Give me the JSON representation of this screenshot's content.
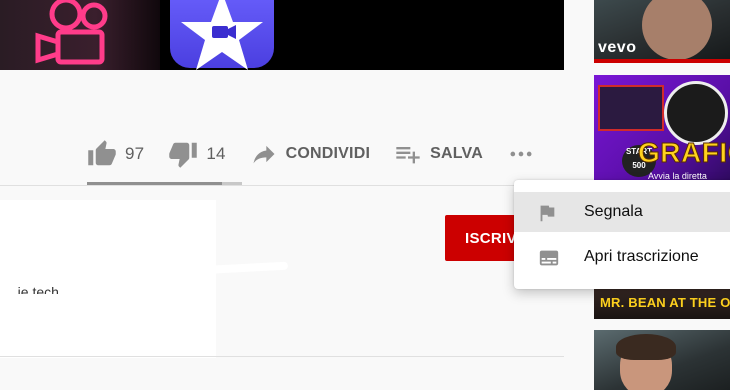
{
  "actions": {
    "like_count": "97",
    "dislike_count": "14",
    "share_label": "CONDIVIDI",
    "save_label": "SALVA",
    "like_ratio": 0.87
  },
  "channel": {
    "subscribe_label": "ISCRIV",
    "partial_text": "...ie tech"
  },
  "menu": {
    "items": [
      {
        "label": "Segnala",
        "icon": "flag-icon"
      },
      {
        "label": "Apri trascrizione",
        "icon": "transcript-icon"
      }
    ]
  },
  "sidebar": {
    "thumb1_badge": "vevo",
    "thumb2_title": "GRAFIC",
    "thumb2_badge": "START\n500",
    "thumb2_caption": "Avvia la diretta",
    "thumb3_title": "MR. BEAN AT THE OLYMPIC"
  },
  "colors": {
    "brand_red": "#cc0000",
    "icon_gray": "#909090",
    "text_gray": "#606060",
    "menu_hover": "#e6e6e6"
  }
}
